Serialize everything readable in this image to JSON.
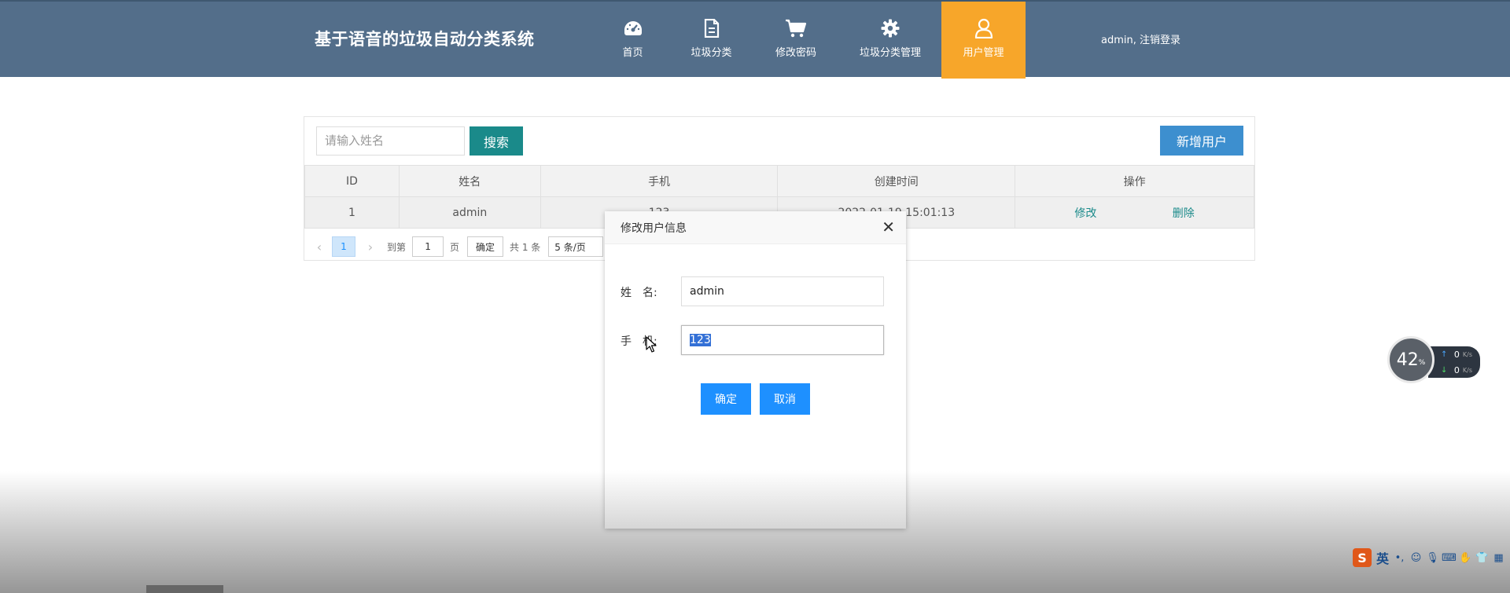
{
  "header": {
    "title": "基于语音的垃圾自动分类系统",
    "nav": [
      {
        "label": "首页",
        "icon": "dashboard-icon"
      },
      {
        "label": "垃圾分类",
        "icon": "document-icon"
      },
      {
        "label": "修改密码",
        "icon": "cart-icon"
      },
      {
        "label": "垃圾分类管理",
        "icon": "gear-icon"
      },
      {
        "label": "用户管理",
        "icon": "user-icon",
        "active": true
      }
    ],
    "user": "admin, 注销登录"
  },
  "toolbar": {
    "search_placeholder": "请输入姓名",
    "search_label": "搜索",
    "add_label": "新增用户"
  },
  "table": {
    "columns": [
      "ID",
      "姓名",
      "手机",
      "创建时间",
      "操作"
    ],
    "rows": [
      {
        "id": "1",
        "name": "admin",
        "phone": "123",
        "created": "2022-01-19 15:01:13",
        "edit": "修改",
        "delete": "删除"
      }
    ]
  },
  "pager": {
    "current": "1",
    "goto_label": "到第",
    "goto_value": "1",
    "page_suffix": "页",
    "confirm": "确定",
    "total": "共 1 条",
    "page_size": "5 条/页"
  },
  "modal": {
    "title": "修改用户信息",
    "name_label": "姓　名:",
    "name_value": "admin",
    "phone_label": "手　机:",
    "phone_value": "123",
    "ok_label": "确定",
    "cancel_label": "取消"
  },
  "net_widget": {
    "percent": "42",
    "unit": "%",
    "up": "0",
    "down": "0",
    "speed_unit": "K/s"
  },
  "ime": {
    "lang": "英"
  },
  "colors": {
    "header_bg": "#536e8a",
    "active_nav": "#f7a62a",
    "search_btn": "#1a8a8a",
    "add_btn": "#3d8fcf",
    "modal_btn": "#1e90ff"
  }
}
